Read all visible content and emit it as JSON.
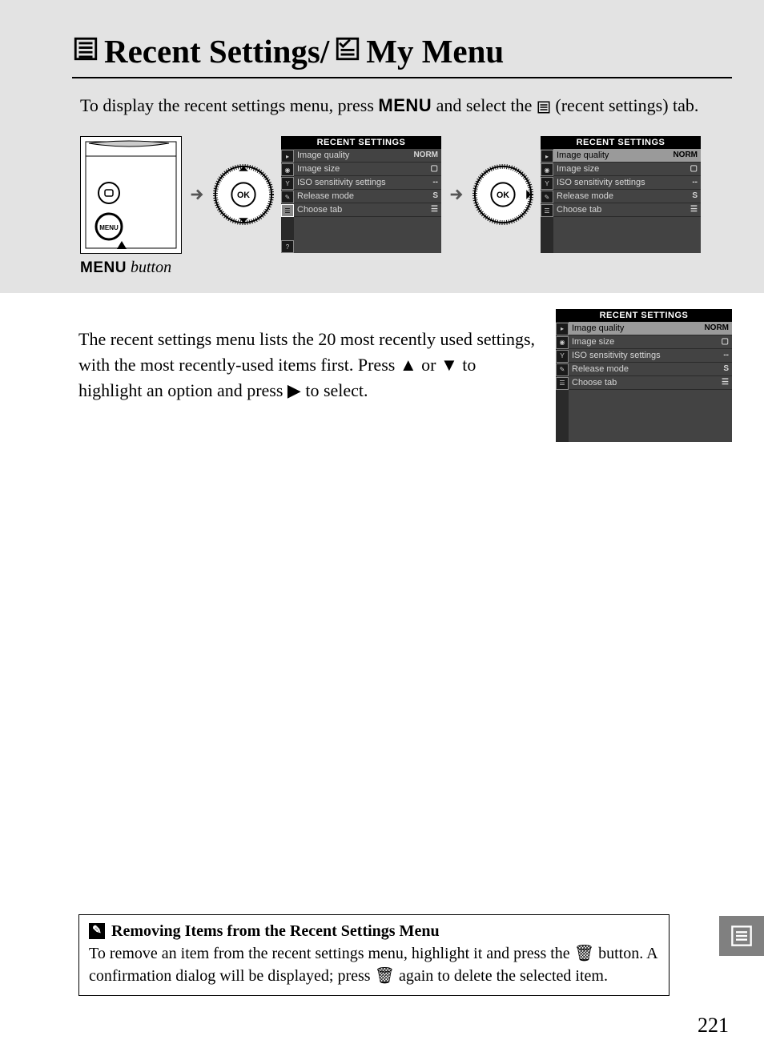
{
  "title": {
    "part1": "Recent Settings/",
    "part2": " My Menu"
  },
  "intro": {
    "pre": "To display the recent settings menu, press ",
    "menu_word": "MENU",
    "mid": " and select the ",
    "post": " (recent settings) tab."
  },
  "caption": {
    "menu_word": "MENU",
    "label": " button"
  },
  "screen_header": "RECENT SETTINGS",
  "rows": [
    {
      "label": "Image quality",
      "val": "NORM"
    },
    {
      "label": "Image size",
      "val": "▢"
    },
    {
      "label": "ISO sensitivity settings",
      "val": "--"
    },
    {
      "label": "Release mode",
      "val": "S"
    },
    {
      "label": "Choose tab",
      "val": "☰"
    }
  ],
  "body": {
    "p1a": "The recent settings menu lists the 20 most recently used settings, with the most recently-used items first.  Press ",
    "p1b": " or ",
    "p1c": " to highlight an option and press ",
    "p1d": " to select."
  },
  "note": {
    "title": "Removing Items from the Recent Settings Menu",
    "body1": "To remove an item from the recent settings menu, highlight it and press the ",
    "body2": " button.  A confirmation dialog will be displayed; press ",
    "body3": " again to delete the selected item."
  },
  "page_number": "221",
  "icons": {
    "trash": "🗑",
    "up": "▲",
    "down": "▼",
    "right": "▶",
    "ok": "OK",
    "question": "?"
  }
}
